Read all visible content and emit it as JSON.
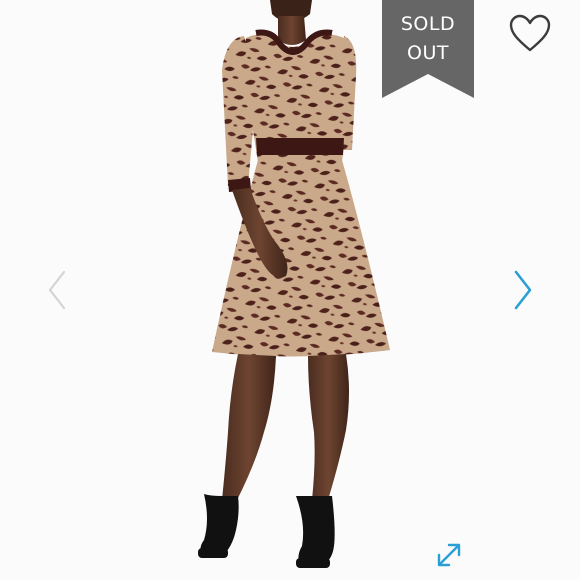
{
  "badge": {
    "line1": "SOLD",
    "line2": "OUT",
    "color": "#666666"
  },
  "icons": {
    "favorite": "heart-outline-icon",
    "previous": "chevron-left-icon",
    "next": "chevron-right-icon",
    "fullscreen": "expand-arrows-icon"
  },
  "colors": {
    "accent": "#2a9fd6",
    "prev_arrow": "#d4d4d4",
    "dress_base": "#c9a98a",
    "dress_dark": "#4a1f1a",
    "trim": "#3d1714"
  }
}
